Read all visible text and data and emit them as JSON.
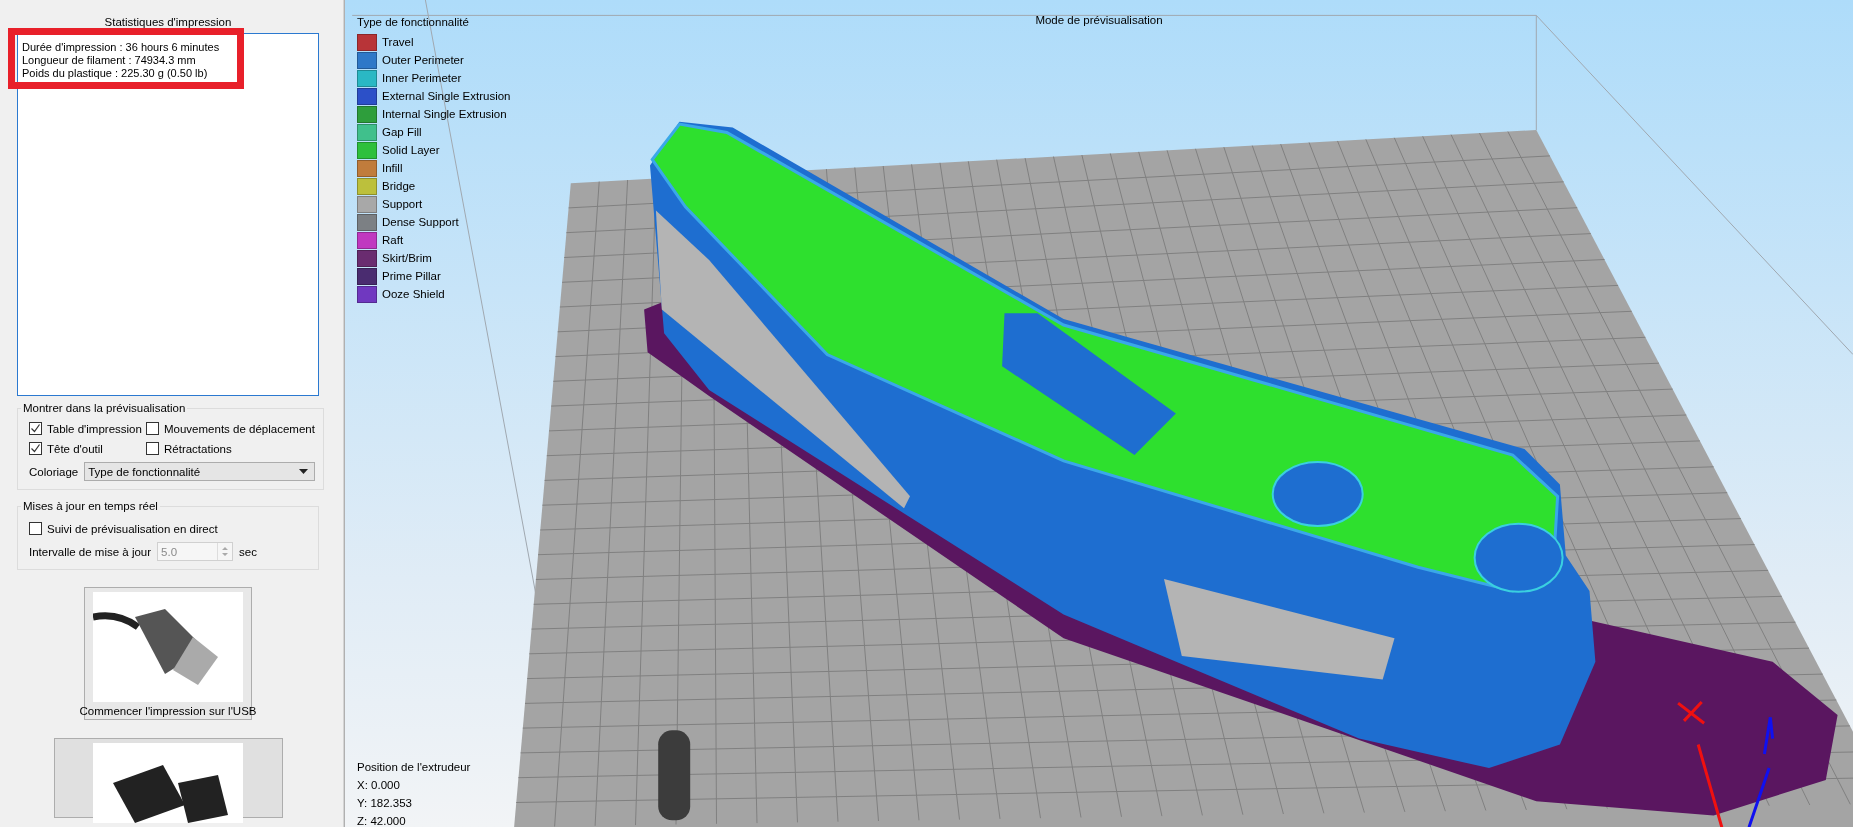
{
  "stats": {
    "title": "Statistiques d'impression",
    "highlighted": true,
    "lines": [
      "Durée d'impression : 36 hours 6 minutes",
      "Longueur de filament : 74934.3 mm",
      "Poids du plastique : 225.30 g (0.50 lb)"
    ]
  },
  "preview_options": {
    "title": "Montrer dans la prévisualisation",
    "checkboxes": [
      {
        "label": "Table d'impression",
        "checked": true
      },
      {
        "label": "Mouvements de déplacement",
        "checked": false
      },
      {
        "label": "Tête d'outil",
        "checked": true
      },
      {
        "label": "Rétractations",
        "checked": false
      }
    ],
    "coloring": {
      "label": "Coloriage",
      "value": "Type de fonctionnalité"
    }
  },
  "realtime": {
    "title": "Mises à jour en temps réel",
    "checkbox": {
      "label": "Suivi de prévisualisation en direct",
      "checked": false
    },
    "interval": {
      "label": "Intervalle de mise à jour",
      "value": "5.0",
      "disabled": true,
      "unit": "sec"
    }
  },
  "print_buttons": [
    {
      "kind": "usb",
      "label": "Commencer l'impression sur l'USB"
    },
    {
      "kind": "sd"
    }
  ],
  "viewport": {
    "title": "Mode de prévisualisation",
    "legend": {
      "title": "Type de fonctionnalité",
      "items": [
        {
          "label": "Travel",
          "color": "#b83438"
        },
        {
          "label": "Outer Perimeter",
          "color": "#2e78c8"
        },
        {
          "label": "Inner Perimeter",
          "color": "#2ab8c4"
        },
        {
          "label": "External Single Extrusion",
          "color": "#2c50c8"
        },
        {
          "label": "Internal Single Extrusion",
          "color": "#2e9e3c"
        },
        {
          "label": "Gap Fill",
          "color": "#40c08c"
        },
        {
          "label": "Solid Layer",
          "color": "#2ec03c"
        },
        {
          "label": "Infill",
          "color": "#c07c3c"
        },
        {
          "label": "Bridge",
          "color": "#bcc03c"
        },
        {
          "label": "Support",
          "color": "#a8a8a8"
        },
        {
          "label": "Dense Support",
          "color": "#7c8084"
        },
        {
          "label": "Raft",
          "color": "#c038c0"
        },
        {
          "label": "Skirt/Brim",
          "color": "#6a2c70"
        },
        {
          "label": "Prime Pillar",
          "color": "#4a2c70"
        },
        {
          "label": "Ooze Shield",
          "color": "#7038c0"
        }
      ]
    },
    "extruder_position": {
      "title": "Position de l'extrudeur",
      "lines": [
        "X: 0.000",
        "Y: 182.353",
        "Z: 42.000"
      ]
    }
  }
}
